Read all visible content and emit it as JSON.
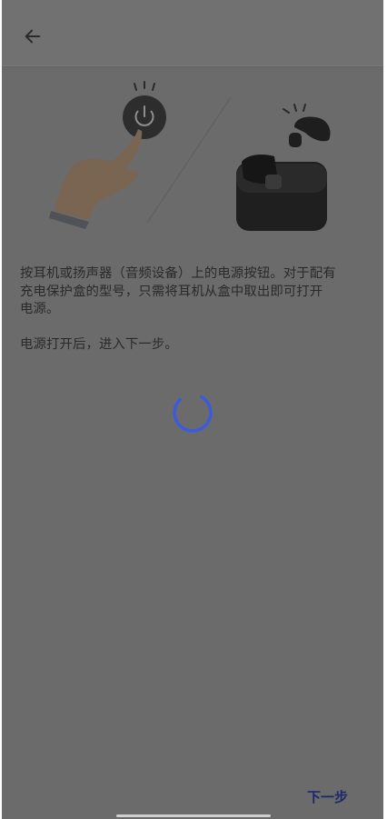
{
  "header": {
    "back_icon": "arrow-left-icon"
  },
  "illustration": {
    "hand_icon": "hand-pressing-power-icon",
    "power_icon": "power-icon",
    "earbuds_icon": "earbuds-case-icon"
  },
  "content": {
    "instruction": "按耳机或扬声器（音频设备）上的电源按钮。对于配有\n充电保护盒的型号，只需将耳机从盒中取出即可打开\n电源。\n\n电源打开后，进入下一步。"
  },
  "loading": {
    "indicator_icon": "loading-spinner-icon",
    "color": "#3b5bdb"
  },
  "footer": {
    "next_label": "下一步"
  },
  "colors": {
    "overlay": "#6b6b6b",
    "accent": "#1d2a6a"
  }
}
